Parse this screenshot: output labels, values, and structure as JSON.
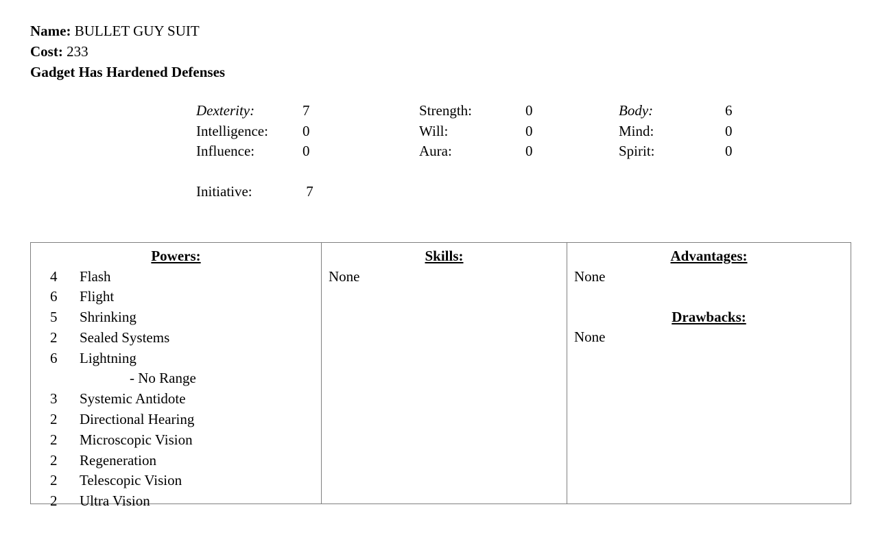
{
  "header": {
    "name_label": "Name:",
    "name_value": "BULLET GUY SUIT",
    "cost_label": "Cost:",
    "cost_value": "233",
    "gadget_note": "Gadget Has Hardened Defenses"
  },
  "attributes": {
    "rows": [
      {
        "c1": {
          "label": "Dexterity:",
          "value": "7",
          "italic": true
        },
        "c2": {
          "label": "Strength:",
          "value": "0",
          "italic": false
        },
        "c3": {
          "label": "Body:",
          "value": "6",
          "italic": true
        }
      },
      {
        "c1": {
          "label": "Intelligence:",
          "value": "0",
          "italic": false
        },
        "c2": {
          "label": "Will:",
          "value": "0",
          "italic": false
        },
        "c3": {
          "label": "Mind:",
          "value": "0",
          "italic": false
        }
      },
      {
        "c1": {
          "label": "Influence:",
          "value": "0",
          "italic": false
        },
        "c2": {
          "label": "Aura:",
          "value": "0",
          "italic": false
        },
        "c3": {
          "label": "Spirit:",
          "value": "0",
          "italic": false
        }
      }
    ],
    "initiative": {
      "label": "Initiative:",
      "value": "7"
    }
  },
  "table": {
    "powers": {
      "heading": "Powers:",
      "items": [
        {
          "rank": "4",
          "name": "Flash",
          "sub": false
        },
        {
          "rank": "6",
          "name": "Flight",
          "sub": false
        },
        {
          "rank": "5",
          "name": "Shrinking",
          "sub": false
        },
        {
          "rank": "2",
          "name": "Sealed Systems",
          "sub": false
        },
        {
          "rank": "6",
          "name": "Lightning",
          "sub": false
        },
        {
          "rank": "",
          "name": "- No Range",
          "sub": true
        },
        {
          "rank": "3",
          "name": "Systemic Antidote",
          "sub": false
        },
        {
          "rank": "2",
          "name": "Directional Hearing",
          "sub": false
        },
        {
          "rank": "2",
          "name": "Microscopic Vision",
          "sub": false
        },
        {
          "rank": "2",
          "name": "Regeneration",
          "sub": false
        },
        {
          "rank": "2",
          "name": "Telescopic Vision",
          "sub": false
        },
        {
          "rank": "2",
          "name": "Ultra Vision",
          "sub": false
        }
      ]
    },
    "skills": {
      "heading": "Skills:",
      "empty_text": "None"
    },
    "advantages": {
      "heading": "Advantages:",
      "empty_text": "None"
    },
    "drawbacks": {
      "heading": "Drawbacks:",
      "empty_text": "None"
    }
  }
}
